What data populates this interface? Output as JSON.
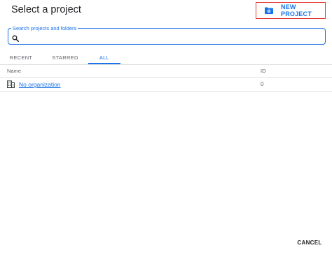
{
  "dialog": {
    "title": "Select a project",
    "new_project_label": "NEW PROJECT",
    "cancel_label": "CANCEL"
  },
  "search": {
    "label": "Search projects and folders",
    "value": ""
  },
  "tabs": [
    {
      "label": "RECENT",
      "active": false
    },
    {
      "label": "STARRED",
      "active": false
    },
    {
      "label": "ALL",
      "active": true
    }
  ],
  "table": {
    "columns": [
      "Name",
      "ID"
    ],
    "rows": [
      {
        "name": "No organization",
        "id": "0",
        "icon": "organization-icon"
      }
    ]
  },
  "colors": {
    "accent": "#1a73e8",
    "highlight_border": "#e53935",
    "divider": "#e0e0e0"
  },
  "icons": {
    "new_project": "new-project-folder-icon",
    "search": "search-icon",
    "organization": "organization-icon"
  }
}
